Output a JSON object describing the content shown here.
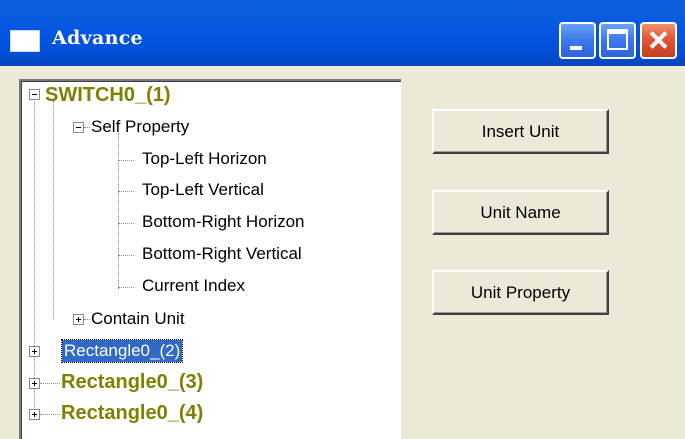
{
  "window": {
    "title": "Advance",
    "controls": {
      "minimize": "minimize-icon",
      "maximize": "maximize-icon",
      "close": "close-icon"
    }
  },
  "tree": {
    "root1": {
      "label": "SWITCH0_(1)",
      "expanded": true
    },
    "self_property": {
      "label": "Self Property",
      "expanded": true
    },
    "items": [
      "Top-Left Horizon",
      "Top-Left Vertical",
      "Bottom-Right Horizon",
      "Bottom-Right Vertical",
      "Current Index"
    ],
    "contain_unit": {
      "label": "Contain Unit",
      "expanded": false
    },
    "root2": {
      "label": "Rectangle0_(2)",
      "selected": true
    },
    "root3": {
      "label": "Rectangle0_(3)"
    },
    "root4": {
      "label": "Rectangle0_(4)"
    }
  },
  "buttons": {
    "insert_unit": "Insert Unit",
    "unit_name": "Unit Name",
    "unit_property": "Unit Property"
  },
  "colors": {
    "titlebar": "#0355e3",
    "face": "#ece9d8",
    "bold_node": "#7f7f00",
    "selection": "#316ac5",
    "close_button": "#e2553a"
  }
}
